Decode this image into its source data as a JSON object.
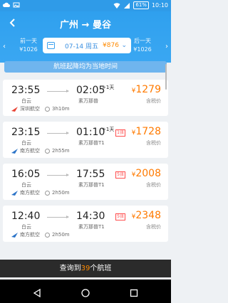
{
  "status": {
    "battery": "61%",
    "time": "10:10"
  },
  "header": {
    "title": "广州 → 曼谷",
    "prev_day": {
      "label": "前一天",
      "price": "¥1026"
    },
    "next_day": {
      "label": "后一天",
      "price": "¥1026"
    },
    "date": {
      "text": "07-14 周五",
      "price": "¥876"
    }
  },
  "notice": "航班起降均为当地时间",
  "flights": [
    {
      "dep_time": "23:55",
      "dep_airport": "白云",
      "arr_time": "02:05",
      "plus_day": "+1天",
      "arr_airport": "素万那普",
      "airline": "深圳航空",
      "airline_color": "#e94435",
      "duration": "3h10m",
      "price": "1279",
      "tax": "含税价",
      "seats": ""
    },
    {
      "dep_time": "23:15",
      "dep_airport": "白云",
      "arr_time": "01:10",
      "plus_day": "+1天",
      "arr_airport": "素万那普T1",
      "airline": "南方航空",
      "airline_color": "#2c74c8",
      "duration": "2h55m",
      "price": "1728",
      "tax": "含税价",
      "seats": "1张"
    },
    {
      "dep_time": "16:05",
      "dep_airport": "白云",
      "arr_time": "17:55",
      "plus_day": "",
      "arr_airport": "素万那普T1",
      "airline": "南方航空",
      "airline_color": "#2c74c8",
      "duration": "2h50m",
      "price": "2008",
      "tax": "含税价",
      "seats": "5张"
    },
    {
      "dep_time": "12:40",
      "dep_airport": "白云",
      "arr_time": "14:30",
      "plus_day": "",
      "arr_airport": "素万那普T1",
      "airline": "南方航空",
      "airline_color": "#2c74c8",
      "duration": "2h50m",
      "price": "2348",
      "tax": "含税价",
      "seats": "5张"
    }
  ],
  "currency": "¥",
  "bottom": {
    "prefix": "查询到",
    "count": "39",
    "suffix": "个航班"
  },
  "colors": {
    "accent": "#2f9be8",
    "price": "#ff7a00"
  }
}
